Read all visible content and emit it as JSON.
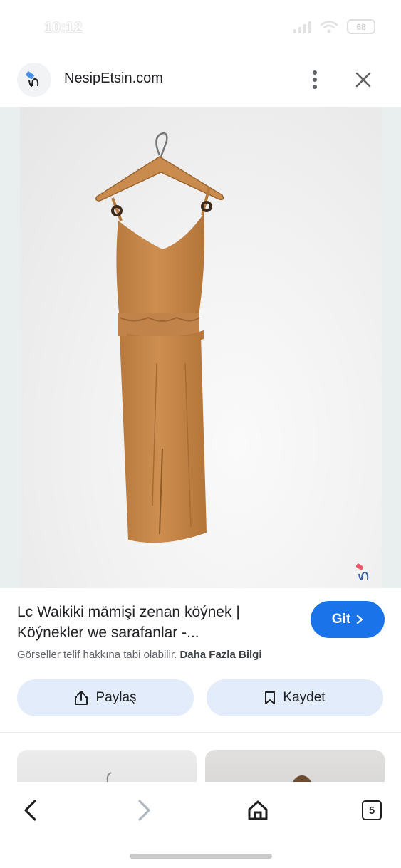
{
  "status_bar": {
    "time": "10:12",
    "battery": "68",
    "icons": [
      "signal-icon",
      "wifi-icon",
      "battery-icon"
    ]
  },
  "header": {
    "site_name": "NesipEtsin.com",
    "icons": [
      "site-logo-icon",
      "more-vert-icon",
      "close-icon"
    ]
  },
  "result": {
    "title": "Lc Waikiki mämişi zenan köýnek | Köýnekler we sarafanlar -...",
    "go_label": "Git",
    "copyright_text": "Görseller telif hakkına tabi olabilir.",
    "more_info": "Daha Fazla Bilgi"
  },
  "actions": {
    "share_label": "Paylaş",
    "save_label": "Kaydet"
  },
  "bottom_nav": {
    "tab_count": "5",
    "icons": [
      "back-icon",
      "forward-icon",
      "home-icon",
      "tabs-icon"
    ]
  },
  "colors": {
    "accent": "#1a73e8",
    "action_button_bg": "#e3ecfa",
    "dress": "#c98a4b"
  }
}
